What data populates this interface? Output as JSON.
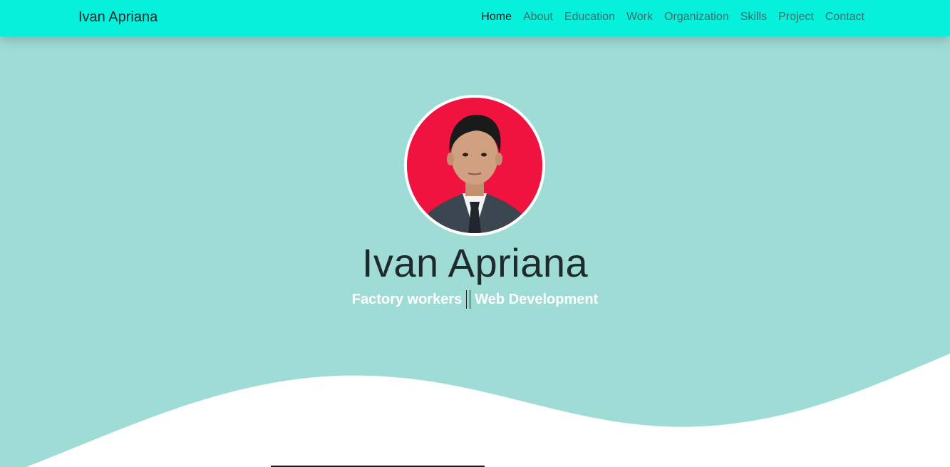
{
  "navbar": {
    "brand": "Ivan Apriana",
    "links": [
      {
        "label": "Home"
      },
      {
        "label": "About"
      },
      {
        "label": "Education"
      },
      {
        "label": "Work"
      },
      {
        "label": "Organization"
      },
      {
        "label": "Skills"
      },
      {
        "label": "Project"
      },
      {
        "label": "Contact"
      }
    ],
    "active": "Home",
    "background_color": "#06f1dc"
  },
  "hero": {
    "name": "Ivan Apriana",
    "subtitle_left": "Factory workers",
    "subtitle_right": "Web Development",
    "background_color": "#a0dcd6",
    "avatar_background_color": "#f0123f"
  }
}
